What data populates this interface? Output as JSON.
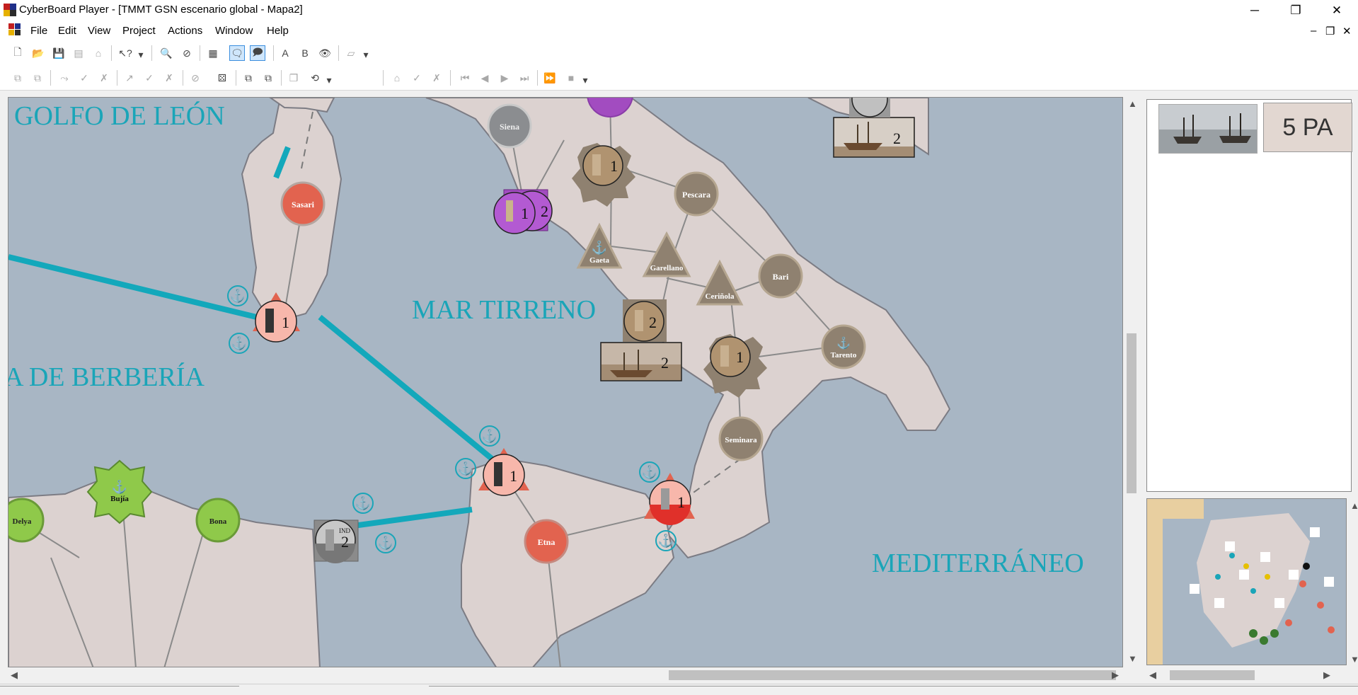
{
  "window": {
    "title": "CyberBoard Player - [TMMT GSN escenario global - Mapa2]",
    "minimize": "─",
    "restore": "❐",
    "close": "✕"
  },
  "menu": {
    "items": [
      "File",
      "Edit",
      "View",
      "Project",
      "Actions",
      "Window",
      "Help"
    ],
    "mdi_minimize": "–",
    "mdi_restore": "❐",
    "mdi_close": "✕"
  },
  "map": {
    "sea_labels": {
      "golfo": "GOLFO DE LEÓN",
      "tirreno": "MAR TIRRENO",
      "berberia": "A DE BERBERÍA",
      "mediterraneo": "MEDITERRÁNEO"
    },
    "cities": {
      "siena": "Siena",
      "sasari": "Sasari",
      "pescara": "Pescara",
      "gaeta": "Gaeta",
      "garellano": "Garellano",
      "bari": "Bari",
      "cerinola": "Ceriñola",
      "tarento": "Tarento",
      "seminara": "Seminara",
      "etna": "Etna",
      "bujia": "Bujía",
      "delya": "Delya",
      "bona": "Bona"
    },
    "counters": {
      "purple_a": "1",
      "purple_b": "2",
      "brown_top": "1",
      "brown_gaeta": "2",
      "ship_gaeta": "2",
      "brown_cerinola": "1",
      "ship_top": "2",
      "red_sasari": "1",
      "red_sicily": "1",
      "red_calabria": "1",
      "grey_ind": "2",
      "ind_label": "IND"
    },
    "anchor_glyph": "⚓"
  },
  "tray": {
    "points": "5 PA"
  },
  "colors": {
    "sea": "#a8b6c4",
    "land": "#dcd2d0",
    "route": "#13a8bb",
    "spanish_red": "#e2634f",
    "brown_unit": "#8f8170",
    "purple_unit": "#a24cc0",
    "african_green": "#8fc94a"
  },
  "icons": [
    "new-icon",
    "open-icon",
    "save-icon",
    "help-pointer-icon",
    "zoom-icon",
    "speech-bubble-icon",
    "dice-icon",
    "play-icon",
    "stop-icon"
  ]
}
